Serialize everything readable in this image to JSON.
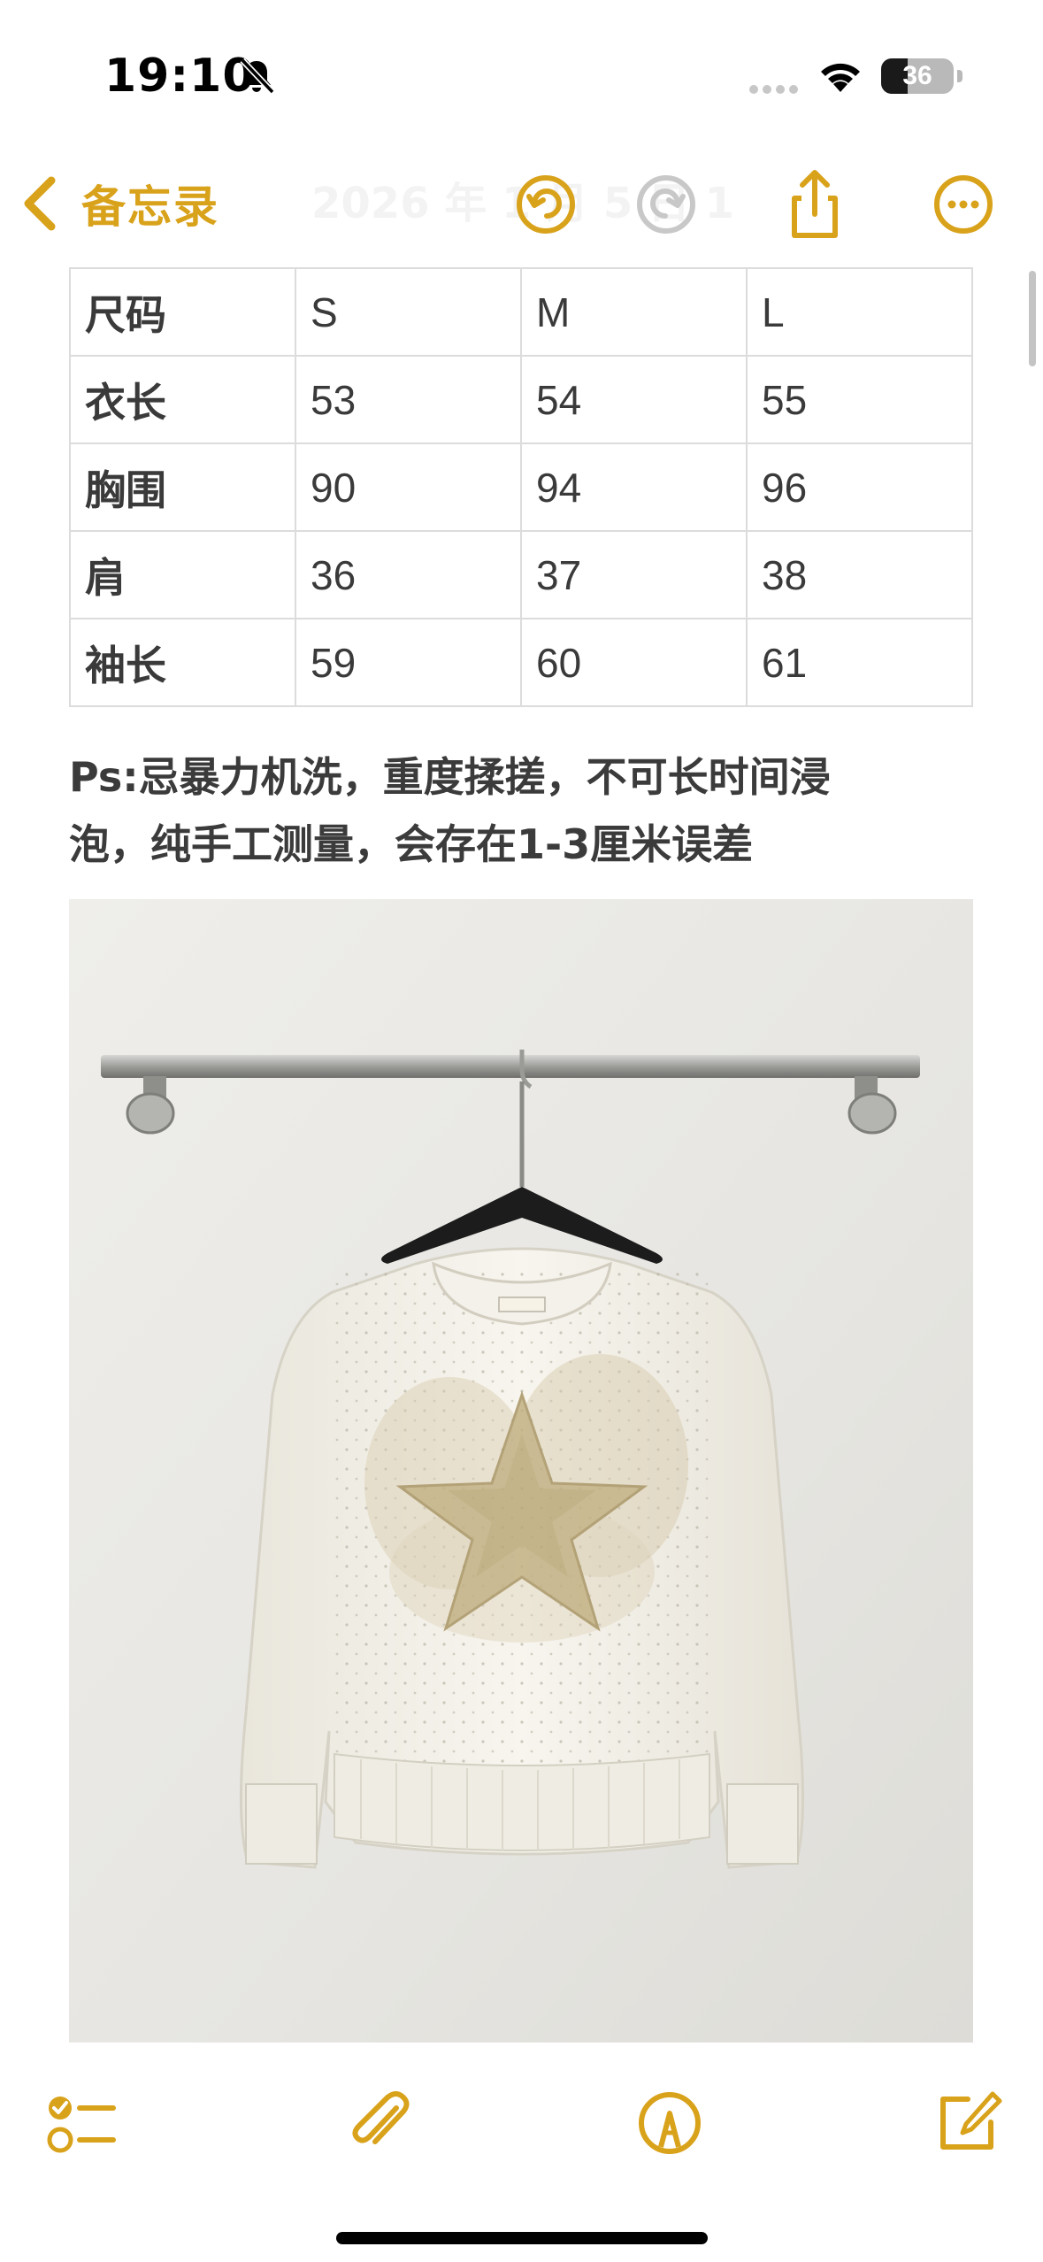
{
  "status_bar": {
    "time": "19:10",
    "battery_level": "36",
    "battery_fraction": 0.36,
    "icons": [
      "bell-slash-icon",
      "cellular-signal-icon",
      "wifi-icon",
      "battery-icon"
    ]
  },
  "nav": {
    "back_label": "备忘录",
    "faded_title": "2026 年 1 月 5 日 19:10",
    "icons": [
      "chevron-left-icon",
      "undo-icon",
      "redo-icon",
      "share-icon",
      "more-icon"
    ]
  },
  "size_table": {
    "header": [
      "尺码",
      "S",
      "M",
      "L"
    ],
    "rows": [
      [
        "衣长",
        "53",
        "54",
        "55"
      ],
      [
        "胸围",
        "90",
        "94",
        "96"
      ],
      [
        "肩",
        "36",
        "37",
        "38"
      ],
      [
        "袖长",
        "59",
        "60",
        "61"
      ]
    ]
  },
  "note": {
    "line1": "Ps:忌暴力机洗，重度揉搓，不可长时间浸",
    "line2": "泡，纯手工测量，会存在1-3厘米误差"
  },
  "toolbar": {
    "icons": [
      "checklist-icon",
      "paperclip-icon",
      "markup-pen-icon",
      "compose-icon"
    ]
  },
  "colors": {
    "accent": "#d9a21b",
    "disabled": "#c8c8c8",
    "text": "#3b3b3b",
    "table_border": "#dcdcdc"
  }
}
